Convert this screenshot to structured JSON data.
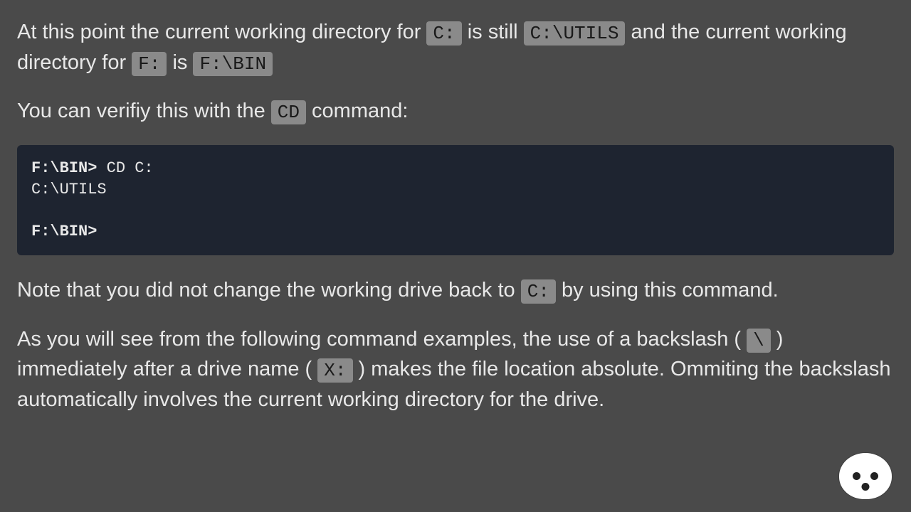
{
  "para1": {
    "seg1": "At this point the current working directory for ",
    "code1": "C:",
    "seg2": " is still ",
    "code2": "C:\\UTILS",
    "seg3": " and the current working directory for ",
    "code3": "F:",
    "seg4": " is ",
    "code4": "F:\\BIN"
  },
  "para2": {
    "seg1": "You can verifiy this with the ",
    "code1": "CD",
    "seg2": " command:"
  },
  "codeblock": {
    "prompt1": "F:\\BIN>",
    "cmd1": " CD C:",
    "out1": "C:\\UTILS",
    "blank": "",
    "prompt2": "F:\\BIN>"
  },
  "para3": {
    "seg1": "Note that you did not change the working drive back to ",
    "code1": "C:",
    "seg2": " by using this command."
  },
  "para4": {
    "seg1": "As you will see from the following command examples, the use of a backslash ( ",
    "code1": "\\",
    "seg2": " ) immediately after a drive name ( ",
    "code2": "X:",
    "seg3": " ) makes the file location absolute. Ommiting the backslash automatically involves the current working directory for the drive."
  }
}
